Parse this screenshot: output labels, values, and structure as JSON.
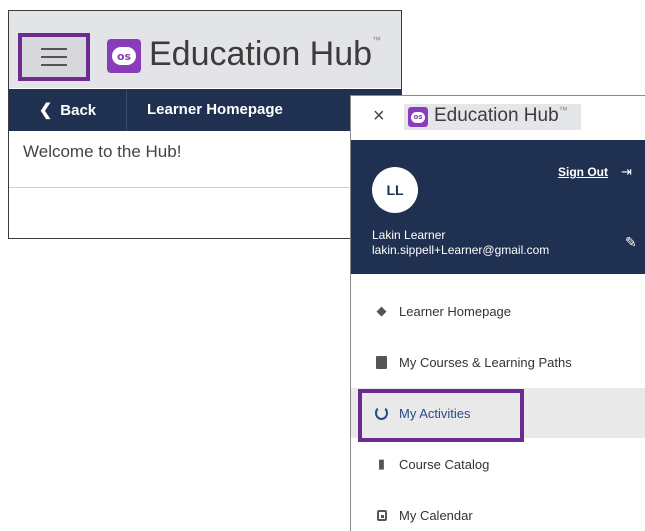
{
  "app": {
    "brand_name": "Education Hub",
    "trademark": "™",
    "logo_text": "os"
  },
  "header": {
    "menu_icon": "hamburger-menu-icon",
    "back_label": "Back",
    "back_icon": "chevron-left-icon",
    "page_title": "Learner Homepage"
  },
  "content": {
    "welcome": "Welcome to the Hub!"
  },
  "side_menu": {
    "close_icon": "close-icon",
    "close_glyph": "×",
    "user": {
      "initials": "LL",
      "name": "Lakin Learner",
      "email": "lakin.sippell+Learner@gmail.com"
    },
    "sign_out_label": "Sign Out",
    "sign_out_icon": "sign-out-icon",
    "edit_icon": "pencil-icon",
    "items": [
      {
        "label": "Learner Homepage",
        "icon": "graduation-cap-icon",
        "active": false
      },
      {
        "label": "My Courses & Learning Paths",
        "icon": "book-icon",
        "active": false
      },
      {
        "label": "My Activities",
        "icon": "circle-progress-icon",
        "active": true
      },
      {
        "label": "Course Catalog",
        "icon": "catalog-icon",
        "active": false
      },
      {
        "label": "My Calendar",
        "icon": "calendar-icon",
        "active": false
      }
    ]
  },
  "colors": {
    "navy": "#1f3050",
    "highlight_purple": "#6b2b91",
    "logo_purple": "#8a3dbb",
    "active_text": "#2a4a8a"
  }
}
